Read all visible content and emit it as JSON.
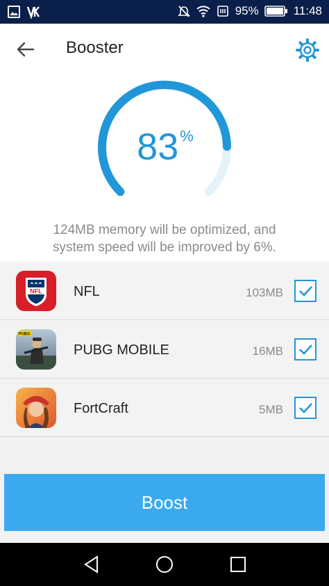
{
  "status_bar": {
    "battery": "95%",
    "time": "11:48",
    "icons": [
      "image-icon",
      "vpn-icon",
      "mute-icon",
      "wifi-icon",
      "card-icon",
      "battery-icon"
    ]
  },
  "header": {
    "title": "Booster",
    "back_icon": "back-arrow-icon",
    "settings_icon": "gear-icon"
  },
  "gauge": {
    "percent": "83",
    "percent_sign": "%",
    "level": 0.83,
    "accent": "#2196d9"
  },
  "message": {
    "line1": "124MB memory will be optimized, and",
    "line2": "system speed will be improved by 6%."
  },
  "apps": [
    {
      "name": "NFL",
      "size": "103MB",
      "checked": true,
      "icon": "nfl-icon",
      "icon_text": "NFL"
    },
    {
      "name": "PUBG MOBILE",
      "size": "16MB",
      "checked": true,
      "icon": "pubg-icon",
      "icon_text": "PUBG"
    },
    {
      "name": "FortCraft",
      "size": "5MB",
      "checked": true,
      "icon": "fortcraft-icon"
    }
  ],
  "boost_button": {
    "label": "Boost",
    "color": "#3aa9f0"
  },
  "nav_bar": {
    "icons": [
      "back-triangle-icon",
      "home-circle-icon",
      "recents-square-icon"
    ]
  }
}
